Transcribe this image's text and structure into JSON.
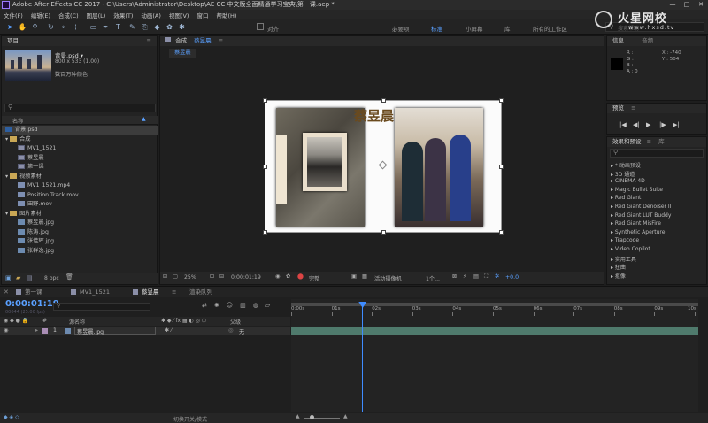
{
  "title_bar": {
    "text": "Adobe After Effects CC 2017 - C:\\Users\\Administrator\\Desktop\\AE CC 中文版全面精通学习宝典\\第一课.aep *",
    "controls": [
      "—",
      "□",
      "✕"
    ]
  },
  "menu": [
    "文件(F)",
    "编辑(E)",
    "合成(C)",
    "图层(L)",
    "效果(T)",
    "动画(A)",
    "视图(V)",
    "窗口",
    "帮助(H)"
  ],
  "toolbar": {
    "tools": [
      "selection-tool",
      "hand-tool",
      "zoom-tool",
      "rotate-tool",
      "camera-tool",
      "pan-behind-tool",
      "rectangle-tool",
      "pen-tool",
      "type-tool",
      "brush-tool",
      "clone-tool",
      "eraser-tool",
      "roto-tool",
      "puppet-tool"
    ],
    "snap_label": "对齐",
    "workspaces": [
      "必要项",
      "标准",
      "小屏幕",
      "库",
      "所有的工作区"
    ],
    "active_workspace": "标准",
    "search_placeholder": "搜索帮助"
  },
  "watermark": {
    "brand": "火星网校",
    "url": "www.hxsd.tv"
  },
  "project": {
    "panel_title": "项目",
    "preview": {
      "name": "背景.psd ▾",
      "size": "800 x 533 (1.00)",
      "color": "数百万种颜色"
    },
    "search_placeholder": "",
    "column_name": "名称",
    "items": [
      {
        "label": "背景.psd",
        "icon": "psd",
        "indent": 0,
        "selected": true
      },
      {
        "label": "合成",
        "icon": "folder",
        "indent": 0,
        "toggle": "▾"
      },
      {
        "label": "MV1_1521",
        "icon": "comp",
        "indent": 1
      },
      {
        "label": "蔡昱晨",
        "icon": "comp",
        "indent": 1
      },
      {
        "label": "第一课",
        "icon": "comp",
        "indent": 1
      },
      {
        "label": "视频素材",
        "icon": "folder",
        "indent": 0,
        "toggle": "▾"
      },
      {
        "label": "MV1_1521.mp4",
        "icon": "vid",
        "indent": 1
      },
      {
        "label": "Position Track.mov",
        "icon": "vid",
        "indent": 1
      },
      {
        "label": "田野.mov",
        "icon": "vid",
        "indent": 1
      },
      {
        "label": "图片素材",
        "icon": "folder",
        "indent": 0,
        "toggle": "▾"
      },
      {
        "label": "蔡昱晨.jpg",
        "icon": "img",
        "indent": 1
      },
      {
        "label": "陈涛.jpg",
        "icon": "img",
        "indent": 1
      },
      {
        "label": "张佳辉.jpg",
        "icon": "img",
        "indent": 1
      },
      {
        "label": "张群逸.jpg",
        "icon": "img",
        "indent": 1
      }
    ],
    "bpc": "8 bpc"
  },
  "composition": {
    "panel_title": "合成",
    "comp_name": "蔡昱晨",
    "tab_label": "蔡昱晨",
    "menu_icon": "≡",
    "canvas_text": "蔡昱晨",
    "footer": {
      "zoom": "25%",
      "timecode": "0:00:01:19",
      "resolution": "完整",
      "camera": "活动摄像机",
      "views": "1个...",
      "exposure": "+0.0"
    }
  },
  "info_panel": {
    "tabs": [
      "信息",
      "音频"
    ],
    "rgba": [
      "R :",
      "G :",
      "B :",
      "A : 0"
    ],
    "coords": [
      "X : -740",
      "Y : 504"
    ]
  },
  "preview_panel": {
    "title": "预览",
    "buttons": [
      "|◀",
      "◀|",
      "▶",
      "|▶",
      "▶|"
    ]
  },
  "effects": {
    "tabs": [
      "效果和预设",
      "库"
    ],
    "search_placeholder": "",
    "items": [
      "* 动画预设",
      "3D 通道",
      "CINEMA 4D",
      "Magic Bullet Suite",
      "Red Giant",
      "Red Giant Denoiser II",
      "Red Giant LUT Buddy",
      "Red Giant MisFire",
      "Synthetic Aperture",
      "Trapcode",
      "Video Copilot",
      "实用工具",
      "扭曲",
      "抠像"
    ]
  },
  "timeline": {
    "tabs": [
      "第一课",
      "MV1_1521",
      "蔡昱晨",
      "渲染队列"
    ],
    "active_tab": "蔡昱晨",
    "timecode": "0:00:01:19",
    "fps": "00044 (25.00 fps)",
    "column_headers": {
      "num": "#",
      "source": "源名称",
      "parent": "父级"
    },
    "layer": {
      "num": "1",
      "name": "蔡昱晨.jpg",
      "parent": "无"
    },
    "ruler": [
      "0:00s",
      "01s",
      "02s",
      "03s",
      "04s",
      "05s",
      "06s",
      "07s",
      "08s",
      "09s",
      "10s"
    ],
    "current_time_seconds": 1.76,
    "duration_seconds": 10,
    "footer_label": "切换开关/模式"
  }
}
